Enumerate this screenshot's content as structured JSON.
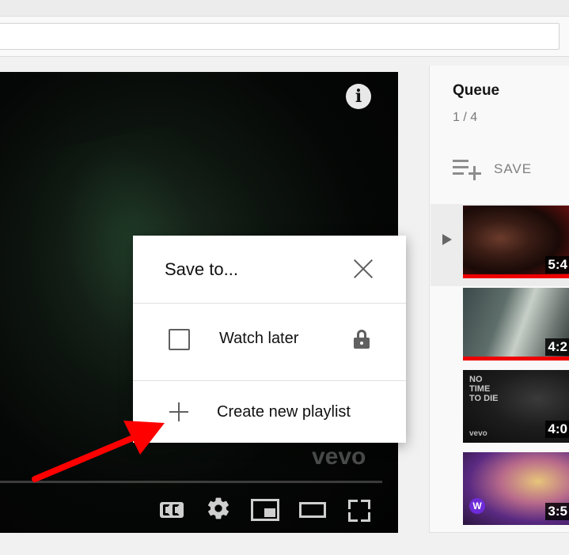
{
  "queue": {
    "title": "Queue",
    "count": "1 / 4",
    "save_label": "SAVE",
    "items": [
      {
        "duration": "5:4"
      },
      {
        "duration": "4:2"
      },
      {
        "duration": "4:0",
        "poster_text": "NO TIME TO DIE",
        "label_text": "vevo"
      },
      {
        "duration": "3:5",
        "badge_text": "W"
      }
    ]
  },
  "player": {
    "info_icon": "i",
    "watermark": "vevo"
  },
  "dialog": {
    "title": "Save to...",
    "watch_later_label": "Watch later",
    "create_playlist_label": "Create new playlist"
  },
  "colors": {
    "annotation_arrow": "#ff0000",
    "progress_bar": "#e00000"
  }
}
